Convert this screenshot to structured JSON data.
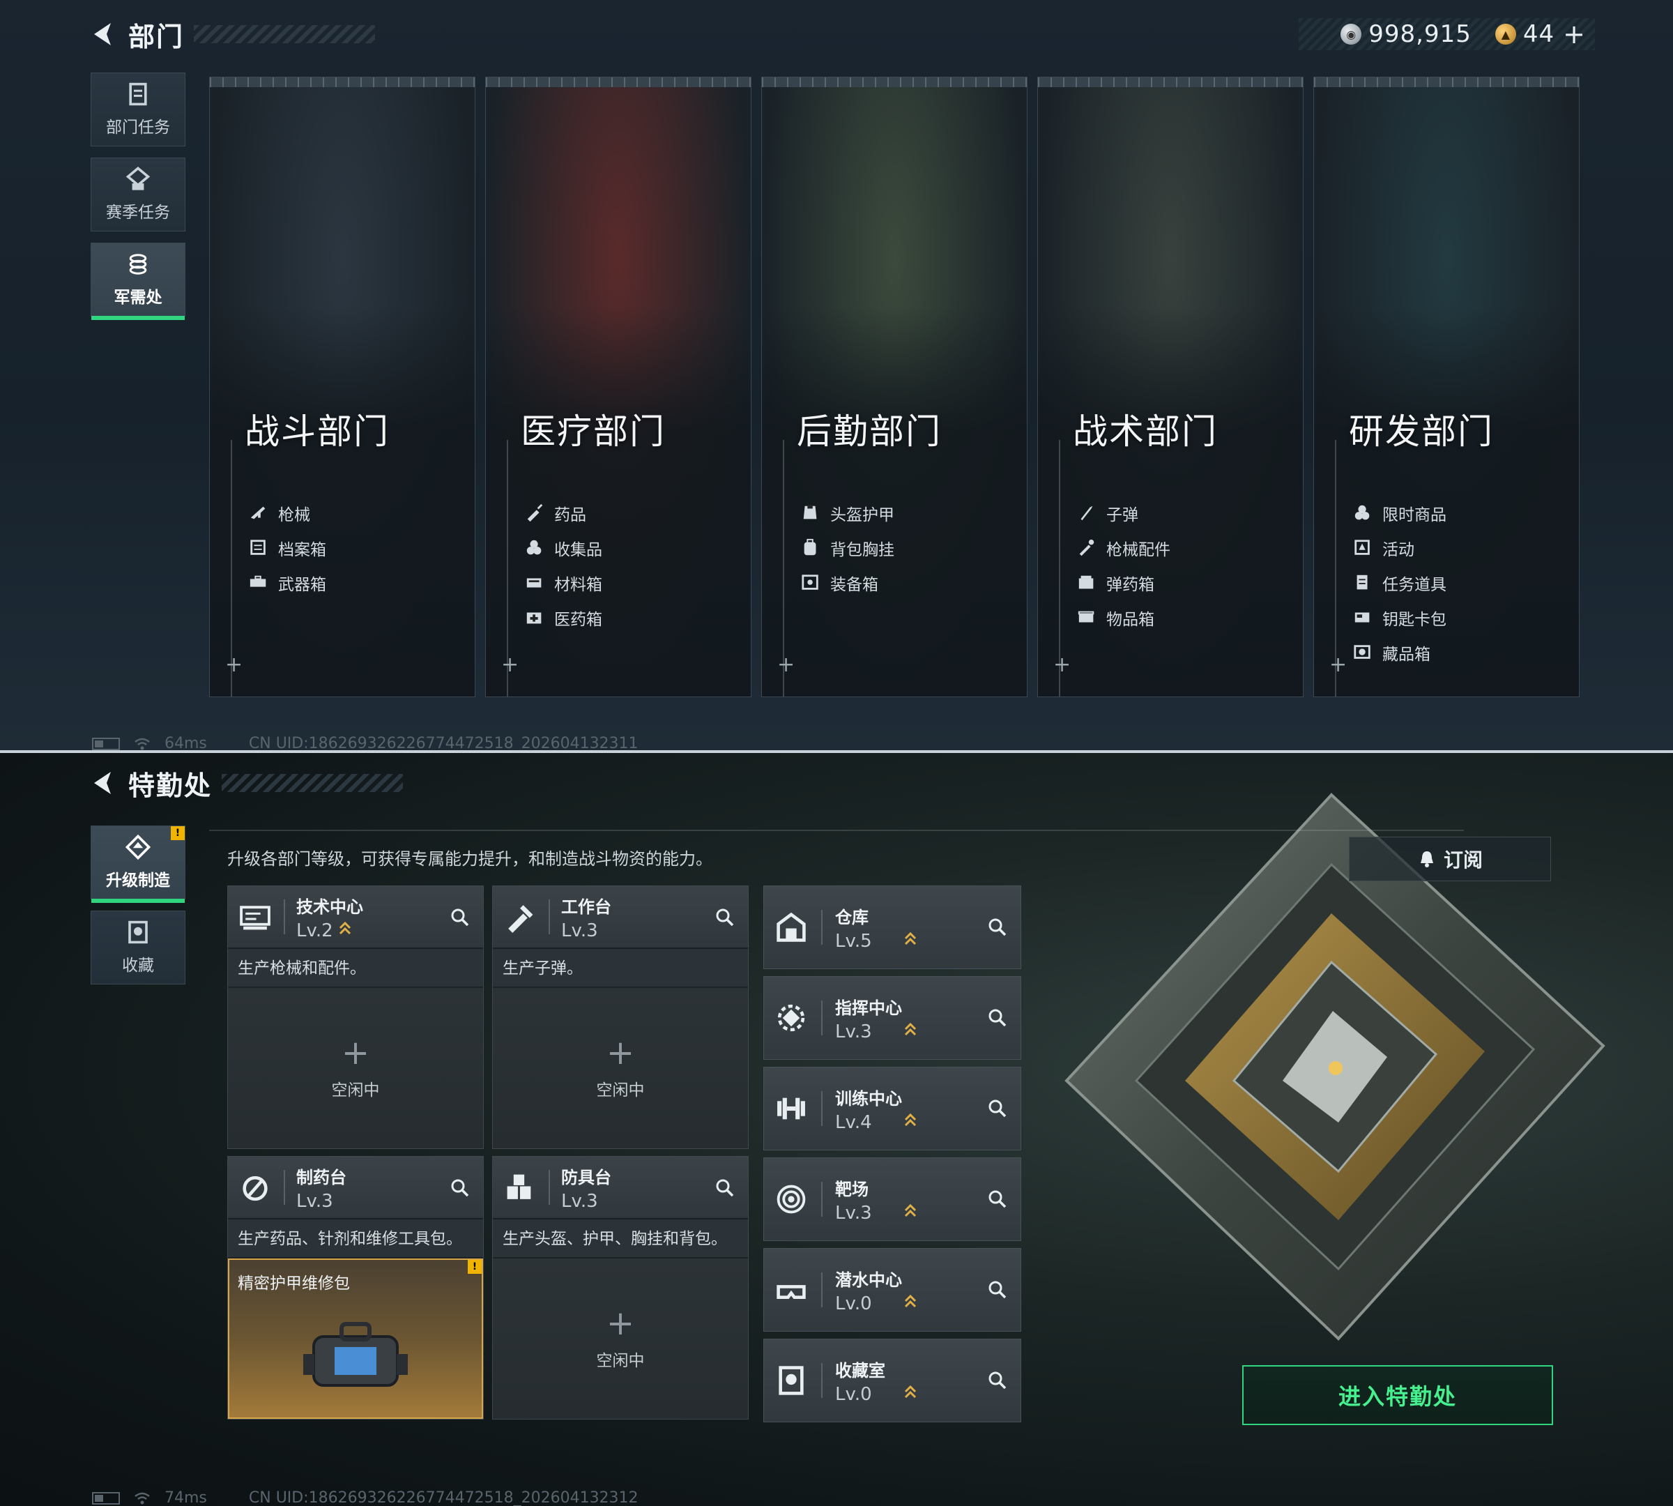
{
  "top": {
    "header": {
      "title": "部门"
    },
    "currency": {
      "silver_value": "998,915",
      "gold_value": "44"
    },
    "sidebar": {
      "items": [
        {
          "label": "部门任务",
          "icon": "task-icon",
          "active": false
        },
        {
          "label": "赛季任务",
          "icon": "season-icon",
          "active": false
        },
        {
          "label": "军需处",
          "icon": "supply-icon",
          "active": true
        }
      ]
    },
    "departments": [
      {
        "title": "战斗部门",
        "theme": "#2b3640",
        "items": [
          {
            "label": "枪械",
            "icon": "rifle-icon"
          },
          {
            "label": "档案箱",
            "icon": "file-box-icon"
          },
          {
            "label": "武器箱",
            "icon": "weapon-case-icon"
          }
        ]
      },
      {
        "title": "医疗部门",
        "theme": "#5a2a2a",
        "items": [
          {
            "label": "药品",
            "icon": "syringe-icon"
          },
          {
            "label": "收集品",
            "icon": "collectible-icon"
          },
          {
            "label": "材料箱",
            "icon": "material-box-icon"
          },
          {
            "label": "医药箱",
            "icon": "medkit-icon"
          }
        ]
      },
      {
        "title": "后勤部门",
        "theme": "#3b4a3c",
        "items": [
          {
            "label": "头盔护甲",
            "icon": "armor-icon"
          },
          {
            "label": "背包胸挂",
            "icon": "backpack-icon"
          },
          {
            "label": "装备箱",
            "icon": "gear-box-icon"
          }
        ]
      },
      {
        "title": "战术部门",
        "theme": "#38413d",
        "items": [
          {
            "label": "子弹",
            "icon": "bullet-icon"
          },
          {
            "label": "枪械配件",
            "icon": "attachment-icon"
          },
          {
            "label": "弹药箱",
            "icon": "ammo-box-icon"
          },
          {
            "label": "物品箱",
            "icon": "item-box-icon"
          }
        ]
      },
      {
        "title": "研发部门",
        "theme": "#223a40",
        "items": [
          {
            "label": "限时商品",
            "icon": "limited-icon"
          },
          {
            "label": "活动",
            "icon": "event-icon"
          },
          {
            "label": "任务道具",
            "icon": "quest-item-icon"
          },
          {
            "label": "钥匙卡包",
            "icon": "keycard-icon"
          },
          {
            "label": "藏品箱",
            "icon": "collection-box-icon"
          }
        ]
      }
    ],
    "footer": {
      "ping": "64ms",
      "uid": "CN UID:1862693262267744725​18_202604132311"
    }
  },
  "bottom": {
    "header": {
      "title": "特勤处"
    },
    "description": "升级各部门等级，可获得专属能力提升，和制造战斗物资的能力。",
    "subscribe_label": "订阅",
    "sidebar": {
      "items": [
        {
          "label": "升级制造",
          "icon": "upgrade-icon",
          "active": true,
          "badge": "!"
        },
        {
          "label": "收藏",
          "icon": "collection-icon",
          "active": false
        }
      ]
    },
    "production": [
      {
        "name": "技术中心",
        "level": "Lv.2",
        "upgradable": true,
        "icon": "tech-center-icon",
        "desc": "生产枪械和配件。",
        "slot": {
          "status": "空闲中"
        }
      },
      {
        "name": "工作台",
        "level": "Lv.3",
        "upgradable": false,
        "icon": "workbench-icon",
        "desc": "生产子弹。",
        "slot": {
          "status": "空闲中"
        }
      },
      {
        "name": "制药台",
        "level": "Lv.3",
        "upgradable": false,
        "icon": "pharmacy-icon",
        "desc": "生产药品、针剂和维修工具包。",
        "slot": {
          "item": "精密护甲维修包",
          "badge": "!"
        }
      },
      {
        "name": "防具台",
        "level": "Lv.3",
        "upgradable": false,
        "icon": "armor-bench-icon",
        "desc": "生产头盔、护甲、胸挂和背包。",
        "slot": {
          "status": "空闲中"
        }
      }
    ],
    "facilities": [
      {
        "name": "仓库",
        "level": "Lv.5",
        "icon": "warehouse-icon"
      },
      {
        "name": "指挥中心",
        "level": "Lv.3",
        "icon": "command-center-icon"
      },
      {
        "name": "训练中心",
        "level": "Lv.4",
        "icon": "training-icon"
      },
      {
        "name": "靶场",
        "level": "Lv.3",
        "icon": "shooting-range-icon"
      },
      {
        "name": "潜水中心",
        "level": "Lv.0",
        "icon": "diving-icon"
      },
      {
        "name": "收藏室",
        "level": "Lv.0",
        "icon": "collection-room-icon"
      }
    ],
    "enter_label": "进入特勤处",
    "footer": {
      "ping": "74ms",
      "uid": "CN UID:186269326226774472518_202604132312"
    },
    "accent": "#2fd57f"
  }
}
